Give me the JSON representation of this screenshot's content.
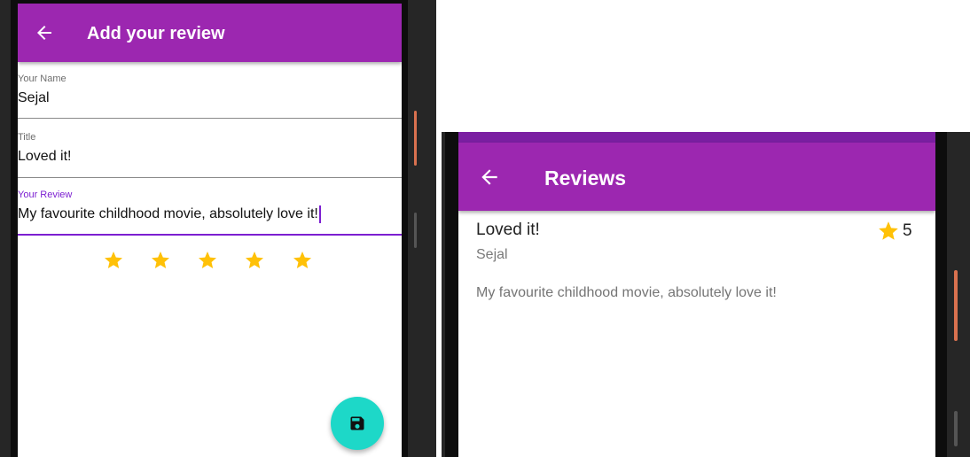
{
  "add_review_screen": {
    "appbar": {
      "title": "Add your review",
      "back_icon": "arrow-left-icon"
    },
    "fields": {
      "name": {
        "label": "Your Name",
        "value": "Sejal"
      },
      "title": {
        "label": "Title",
        "value": "Loved it!"
      },
      "review": {
        "label": "Your Review",
        "value": "My favourite childhood movie, absolutely love it!"
      }
    },
    "rating": {
      "value": 5,
      "max": 5,
      "icon": "star-icon"
    },
    "fab": {
      "icon": "save-icon"
    }
  },
  "reviews_screen": {
    "appbar": {
      "title": "Reviews",
      "back_icon": "arrow-left-icon"
    },
    "reviews": [
      {
        "title": "Loved it!",
        "author": "Sejal",
        "rating": "5",
        "body": "My favourite childhood movie, absolutely love it!"
      }
    ]
  },
  "colors": {
    "primary": "#9c27b0",
    "primary_dark": "#7b1fa2",
    "accent_focus": "#7c1fd1",
    "star": "#ffc107",
    "fab": "#1dd8c8"
  }
}
